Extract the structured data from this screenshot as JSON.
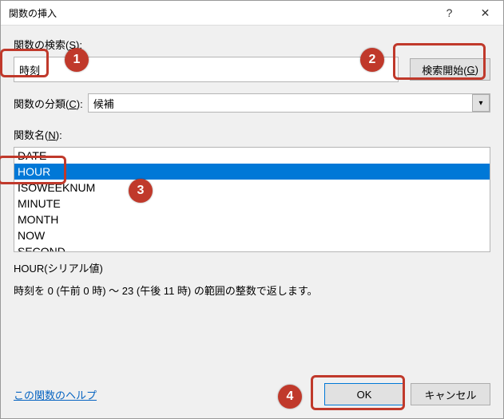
{
  "title": "関数の挿入",
  "titlebar": {
    "help_icon": "?",
    "close_icon": "✕"
  },
  "search": {
    "label_prefix": "関数の検索(",
    "label_acc": "S",
    "label_suffix": "):",
    "value": "時刻",
    "go_prefix": "検索開始(",
    "go_acc": "G",
    "go_suffix": ")"
  },
  "category": {
    "label_prefix": "関数の分類(",
    "label_acc": "C",
    "label_suffix": "):",
    "value": "候補"
  },
  "funcname": {
    "label_prefix": "関数名(",
    "label_acc": "N",
    "label_suffix": "):"
  },
  "functions": [
    {
      "name": "DATE",
      "selected": false
    },
    {
      "name": "HOUR",
      "selected": true
    },
    {
      "name": "ISOWEEKNUM",
      "selected": false
    },
    {
      "name": "MINUTE",
      "selected": false
    },
    {
      "name": "MONTH",
      "selected": false
    },
    {
      "name": "NOW",
      "selected": false
    },
    {
      "name": "SECOND",
      "selected": false
    }
  ],
  "description": {
    "signature": "HOUR(シリアル値)",
    "text": "時刻を 0 (午前 0 時) ～ 23 (午後 11 時) の範囲の整数で返します。"
  },
  "footer": {
    "help_link": "この関数のヘルプ",
    "ok": "OK",
    "cancel": "キャンセル"
  },
  "annotations": {
    "c1": "1",
    "c2": "2",
    "c3": "3",
    "c4": "4"
  }
}
